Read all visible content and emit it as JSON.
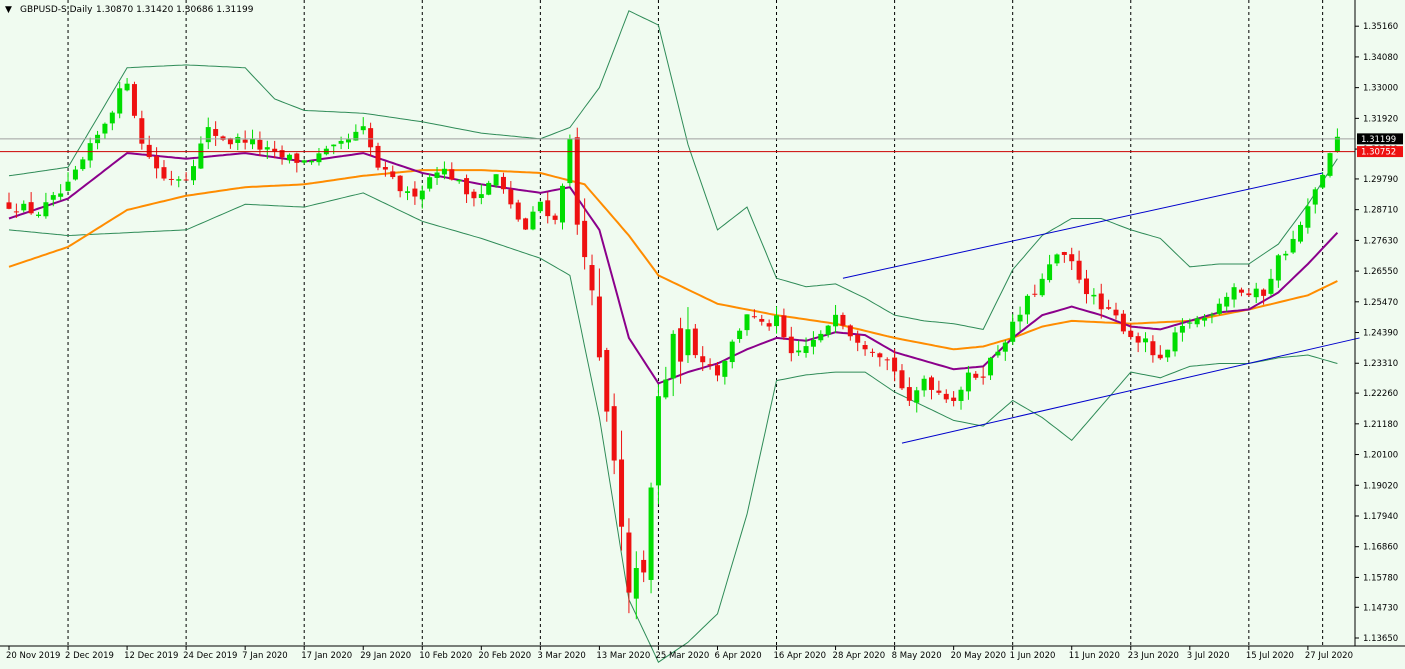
{
  "header": {
    "symbol": "GBPUSD-S,Daily",
    "ohlc": "1.30870 1.31420 1.30686 1.31199"
  },
  "colors": {
    "background": "#f0fbf0",
    "grid": "#000000",
    "bull": "#00dd00",
    "bear": "#ee1111",
    "ma_fast": "#8b008b",
    "ma_slow": "#ff8c00",
    "bollinger": "#2e8b57",
    "trendline": "#0000cc",
    "bid_line": "#a0a0a0",
    "ask_line": "#cc0000",
    "bid_label_bg": "#000000",
    "ask_label_bg": "#ee1111"
  },
  "price_labels": {
    "bid": "1.31199",
    "ask": "1.30752"
  },
  "chart_data": {
    "type": "candlestick",
    "symbol": "GBPUSD-S",
    "timeframe": "Daily",
    "ylim": [
      1.1365,
      1.358
    ],
    "y_ticks": [
      "1.35160",
      "1.34080",
      "1.33000",
      "1.31920",
      "1.30840",
      "1.29790",
      "1.28710",
      "1.27630",
      "1.26550",
      "1.25470",
      "1.24390",
      "1.23310",
      "1.22260",
      "1.21180",
      "1.20100",
      "1.19020",
      "1.17940",
      "1.16860",
      "1.15780",
      "1.14730",
      "1.13650"
    ],
    "x_ticks": [
      {
        "label": "20 Nov 2019",
        "bar": 0
      },
      {
        "label": "2 Dec 2019",
        "bar": 8
      },
      {
        "label": "12 Dec 2019",
        "bar": 16
      },
      {
        "label": "24 Dec 2019",
        "bar": 24
      },
      {
        "label": "7 Jan 2020",
        "bar": 32
      },
      {
        "label": "17 Jan 2020",
        "bar": 40
      },
      {
        "label": "29 Jan 2020",
        "bar": 48
      },
      {
        "label": "10 Feb 2020",
        "bar": 56
      },
      {
        "label": "20 Feb 2020",
        "bar": 64
      },
      {
        "label": "3 Mar 2020",
        "bar": 72
      },
      {
        "label": "13 Mar 2020",
        "bar": 80
      },
      {
        "label": "25 Mar 2020",
        "bar": 88
      },
      {
        "label": "6 Apr 2020",
        "bar": 96
      },
      {
        "label": "16 Apr 2020",
        "bar": 104
      },
      {
        "label": "28 Apr 2020",
        "bar": 112
      },
      {
        "label": "8 May 2020",
        "bar": 120
      },
      {
        "label": "20 May 2020",
        "bar": 128
      },
      {
        "label": "1 Jun 2020",
        "bar": 136
      },
      {
        "label": "11 Jun 2020",
        "bar": 144
      },
      {
        "label": "23 Jun 2020",
        "bar": 152
      },
      {
        "label": "3 Jul 2020",
        "bar": 160
      },
      {
        "label": "15 Jul 2020",
        "bar": 168
      },
      {
        "label": "27 Jul 2020",
        "bar": 176
      }
    ],
    "vgrid_bars": [
      8,
      24,
      40,
      56,
      72,
      88,
      104,
      120,
      136,
      152,
      168,
      178
    ],
    "close_anchors": [
      [
        0,
        1.289
      ],
      [
        4,
        1.286
      ],
      [
        8,
        1.295
      ],
      [
        12,
        1.313
      ],
      [
        16,
        1.333
      ],
      [
        18,
        1.31
      ],
      [
        21,
        1.298
      ],
      [
        24,
        1.299
      ],
      [
        27,
        1.315
      ],
      [
        30,
        1.311
      ],
      [
        32,
        1.312
      ],
      [
        36,
        1.306
      ],
      [
        40,
        1.304
      ],
      [
        44,
        1.308
      ],
      [
        48,
        1.315
      ],
      [
        50,
        1.302
      ],
      [
        54,
        1.292
      ],
      [
        56,
        1.295
      ],
      [
        58,
        1.302
      ],
      [
        60,
        1.299
      ],
      [
        62,
        1.293
      ],
      [
        64,
        1.293
      ],
      [
        66,
        1.299
      ],
      [
        68,
        1.288
      ],
      [
        70,
        1.28
      ],
      [
        72,
        1.29
      ],
      [
        74,
        1.283
      ],
      [
        76,
        1.311
      ],
      [
        77,
        1.282
      ],
      [
        78,
        1.276
      ],
      [
        80,
        1.232
      ],
      [
        82,
        1.196
      ],
      [
        84,
        1.148
      ],
      [
        85,
        1.165
      ],
      [
        86,
        1.155
      ],
      [
        88,
        1.22
      ],
      [
        90,
        1.238
      ],
      [
        92,
        1.24
      ],
      [
        94,
        1.235
      ],
      [
        96,
        1.23
      ],
      [
        98,
        1.24
      ],
      [
        100,
        1.251
      ],
      [
        102,
        1.246
      ],
      [
        104,
        1.248
      ],
      [
        106,
        1.235
      ],
      [
        108,
        1.239
      ],
      [
        110,
        1.242
      ],
      [
        112,
        1.252
      ],
      [
        114,
        1.244
      ],
      [
        116,
        1.24
      ],
      [
        118,
        1.237
      ],
      [
        120,
        1.231
      ],
      [
        122,
        1.218
      ],
      [
        124,
        1.228
      ],
      [
        126,
        1.223
      ],
      [
        128,
        1.221
      ],
      [
        130,
        1.228
      ],
      [
        132,
        1.23
      ],
      [
        134,
        1.238
      ],
      [
        136,
        1.246
      ],
      [
        138,
        1.255
      ],
      [
        140,
        1.262
      ],
      [
        142,
        1.271
      ],
      [
        144,
        1.268
      ],
      [
        146,
        1.259
      ],
      [
        148,
        1.252
      ],
      [
        150,
        1.249
      ],
      [
        152,
        1.243
      ],
      [
        154,
        1.24
      ],
      [
        156,
        1.233
      ],
      [
        158,
        1.242
      ],
      [
        160,
        1.248
      ],
      [
        162,
        1.249
      ],
      [
        164,
        1.255
      ],
      [
        166,
        1.26
      ],
      [
        168,
        1.257
      ],
      [
        170,
        1.258
      ],
      [
        172,
        1.27
      ],
      [
        174,
        1.276
      ],
      [
        176,
        1.287
      ],
      [
        178,
        1.3
      ],
      [
        180,
        1.312
      ]
    ],
    "ma_fast_points": [
      [
        0,
        1.284
      ],
      [
        8,
        1.291
      ],
      [
        16,
        1.307
      ],
      [
        24,
        1.305
      ],
      [
        32,
        1.307
      ],
      [
        40,
        1.304
      ],
      [
        48,
        1.307
      ],
      [
        56,
        1.3
      ],
      [
        64,
        1.296
      ],
      [
        72,
        1.293
      ],
      [
        76,
        1.295
      ],
      [
        80,
        1.28
      ],
      [
        84,
        1.242
      ],
      [
        88,
        1.226
      ],
      [
        92,
        1.23
      ],
      [
        96,
        1.233
      ],
      [
        100,
        1.238
      ],
      [
        104,
        1.242
      ],
      [
        108,
        1.241
      ],
      [
        112,
        1.244
      ],
      [
        116,
        1.243
      ],
      [
        120,
        1.237
      ],
      [
        124,
        1.234
      ],
      [
        128,
        1.231
      ],
      [
        132,
        1.232
      ],
      [
        136,
        1.242
      ],
      [
        140,
        1.25
      ],
      [
        144,
        1.253
      ],
      [
        148,
        1.25
      ],
      [
        152,
        1.246
      ],
      [
        156,
        1.245
      ],
      [
        160,
        1.248
      ],
      [
        164,
        1.251
      ],
      [
        168,
        1.252
      ],
      [
        172,
        1.258
      ],
      [
        176,
        1.268
      ],
      [
        180,
        1.279
      ]
    ],
    "ma_slow_points": [
      [
        0,
        1.267
      ],
      [
        8,
        1.274
      ],
      [
        16,
        1.287
      ],
      [
        24,
        1.292
      ],
      [
        32,
        1.295
      ],
      [
        40,
        1.296
      ],
      [
        48,
        1.299
      ],
      [
        56,
        1.301
      ],
      [
        64,
        1.301
      ],
      [
        72,
        1.3
      ],
      [
        78,
        1.296
      ],
      [
        84,
        1.278
      ],
      [
        88,
        1.264
      ],
      [
        96,
        1.254
      ],
      [
        104,
        1.25
      ],
      [
        112,
        1.247
      ],
      [
        120,
        1.242
      ],
      [
        128,
        1.238
      ],
      [
        132,
        1.239
      ],
      [
        136,
        1.242
      ],
      [
        140,
        1.246
      ],
      [
        144,
        1.248
      ],
      [
        152,
        1.247
      ],
      [
        160,
        1.248
      ],
      [
        168,
        1.252
      ],
      [
        176,
        1.257
      ],
      [
        180,
        1.262
      ]
    ],
    "bollinger_upper_points": [
      [
        0,
        1.299
      ],
      [
        8,
        1.302
      ],
      [
        16,
        1.337
      ],
      [
        24,
        1.338
      ],
      [
        32,
        1.337
      ],
      [
        36,
        1.326
      ],
      [
        40,
        1.322
      ],
      [
        48,
        1.321
      ],
      [
        56,
        1.318
      ],
      [
        64,
        1.314
      ],
      [
        72,
        1.312
      ],
      [
        76,
        1.316
      ],
      [
        80,
        1.33
      ],
      [
        84,
        1.357
      ],
      [
        88,
        1.352
      ],
      [
        92,
        1.31
      ],
      [
        96,
        1.28
      ],
      [
        100,
        1.288
      ],
      [
        104,
        1.263
      ],
      [
        108,
        1.26
      ],
      [
        112,
        1.261
      ],
      [
        116,
        1.256
      ],
      [
        120,
        1.25
      ],
      [
        124,
        1.248
      ],
      [
        128,
        1.247
      ],
      [
        132,
        1.245
      ],
      [
        136,
        1.266
      ],
      [
        140,
        1.278
      ],
      [
        144,
        1.284
      ],
      [
        148,
        1.284
      ],
      [
        152,
        1.28
      ],
      [
        156,
        1.277
      ],
      [
        160,
        1.267
      ],
      [
        164,
        1.268
      ],
      [
        168,
        1.268
      ],
      [
        172,
        1.275
      ],
      [
        176,
        1.289
      ],
      [
        180,
        1.305
      ]
    ],
    "bollinger_lower_points": [
      [
        0,
        1.28
      ],
      [
        8,
        1.278
      ],
      [
        16,
        1.279
      ],
      [
        24,
        1.28
      ],
      [
        32,
        1.289
      ],
      [
        40,
        1.288
      ],
      [
        48,
        1.293
      ],
      [
        56,
        1.283
      ],
      [
        64,
        1.277
      ],
      [
        72,
        1.27
      ],
      [
        76,
        1.264
      ],
      [
        80,
        1.214
      ],
      [
        84,
        1.15
      ],
      [
        88,
        1.128
      ],
      [
        92,
        1.135
      ],
      [
        96,
        1.145
      ],
      [
        100,
        1.18
      ],
      [
        104,
        1.227
      ],
      [
        108,
        1.229
      ],
      [
        112,
        1.23
      ],
      [
        116,
        1.23
      ],
      [
        120,
        1.223
      ],
      [
        124,
        1.218
      ],
      [
        128,
        1.213
      ],
      [
        132,
        1.211
      ],
      [
        136,
        1.22
      ],
      [
        140,
        1.214
      ],
      [
        144,
        1.206
      ],
      [
        148,
        1.218
      ],
      [
        152,
        1.23
      ],
      [
        156,
        1.228
      ],
      [
        160,
        1.232
      ],
      [
        164,
        1.233
      ],
      [
        168,
        1.233
      ],
      [
        172,
        1.235
      ],
      [
        176,
        1.236
      ],
      [
        180,
        1.233
      ]
    ],
    "trendlines": [
      {
        "from": [
          113,
          1.263
        ],
        "to": [
          178,
          1.3
        ]
      },
      {
        "from": [
          121,
          1.205
        ],
        "to": [
          183,
          1.242
        ]
      }
    ],
    "bid_level": 1.31199,
    "ask_level": 1.30752
  }
}
